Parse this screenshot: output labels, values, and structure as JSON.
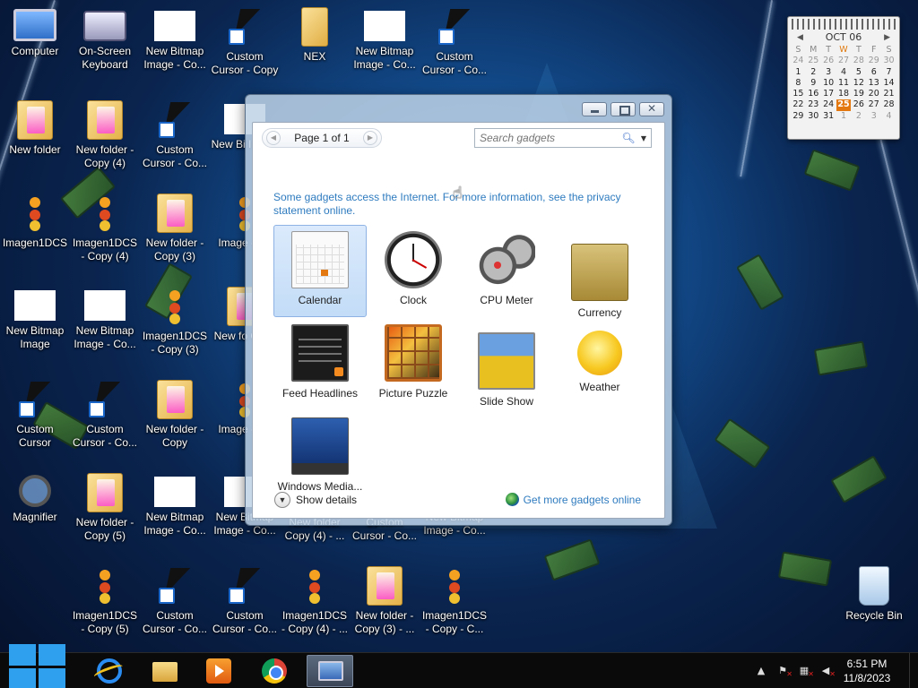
{
  "desktop": {
    "icons": [
      {
        "label": "Computer",
        "type": "computer"
      },
      {
        "label": "On-Screen Keyboard",
        "type": "keyboard"
      },
      {
        "label": "New Bitmap Image - Co...",
        "type": "bitmap"
      },
      {
        "label": "Custom Cursor - Copy",
        "type": "cursor"
      },
      {
        "label": "NEX",
        "type": "nex"
      },
      {
        "label": "New Bitmap Image - Co...",
        "type": "bitmap"
      },
      {
        "label": "Custom Cursor - Co...",
        "type": "cursor"
      },
      {
        "label": "New folder",
        "type": "folder"
      },
      {
        "label": "New folder - Copy (4)",
        "type": "folder"
      },
      {
        "label": "Custom Cursor - Co...",
        "type": "cursor"
      },
      {
        "label": "New Bi Image",
        "type": "bitmap"
      },
      {
        "label": "Imagen1DCS",
        "type": "imagen"
      },
      {
        "label": "Imagen1DCS - Copy (4)",
        "type": "imagen"
      },
      {
        "label": "New folder - Copy (3)",
        "type": "folder"
      },
      {
        "label": "Image - Co",
        "type": "imagen"
      },
      {
        "label": "New Bitmap Image",
        "type": "bitmap"
      },
      {
        "label": "New Bitmap Image - Co...",
        "type": "bitmap"
      },
      {
        "label": "Imagen1DCS - Copy (3)",
        "type": "imagen"
      },
      {
        "label": "New fo Copy",
        "type": "folder"
      },
      {
        "label": "Custom Cursor",
        "type": "cursor"
      },
      {
        "label": "Custom Cursor - Co...",
        "type": "cursor"
      },
      {
        "label": "New folder - Copy",
        "type": "folder"
      },
      {
        "label": "Image - Co",
        "type": "imagen"
      },
      {
        "label": "Magnifier",
        "type": "magnifier"
      },
      {
        "label": "New folder - Copy (5)",
        "type": "folder"
      },
      {
        "label": "New Bitmap Image - Co...",
        "type": "bitmap"
      },
      {
        "label": "New Bitmap Image - Co...",
        "type": "bitmap"
      },
      {
        "label": "New folder Copy (4) - ...",
        "type": "folder"
      },
      {
        "label": "Custom Cursor - Co...",
        "type": "cursor"
      },
      {
        "label": "New Bitmap Image - Co...",
        "type": "bitmap"
      },
      {
        "label": "Imagen1DCS - Copy (5)",
        "type": "imagen"
      },
      {
        "label": "Custom Cursor - Co...",
        "type": "cursor"
      },
      {
        "label": "Custom Cursor - Co...",
        "type": "cursor"
      },
      {
        "label": "Imagen1DCS - Copy (4) - ...",
        "type": "imagen"
      },
      {
        "label": "New folder - Copy (3) - ...",
        "type": "folder"
      },
      {
        "label": "Imagen1DCS - Copy - C...",
        "type": "imagen"
      },
      {
        "label": "Recycle Bin",
        "type": "recycle"
      }
    ]
  },
  "calendar_gadget": {
    "month": "OCT 06",
    "dows": [
      "S",
      "M",
      "T",
      "W",
      "T",
      "F",
      "S"
    ],
    "weeks": [
      [
        "24",
        "25",
        "26",
        "27",
        "28",
        "29",
        "30"
      ],
      [
        "1",
        "2",
        "3",
        "4",
        "5",
        "6",
        "7"
      ],
      [
        "8",
        "9",
        "10",
        "11",
        "12",
        "13",
        "14"
      ],
      [
        "15",
        "16",
        "17",
        "18",
        "19",
        "20",
        "21"
      ],
      [
        "22",
        "23",
        "24",
        "25",
        "26",
        "27",
        "28"
      ],
      [
        "29",
        "30",
        "31",
        "1",
        "2",
        "3",
        "4"
      ]
    ],
    "today": "25"
  },
  "gadget_window": {
    "pager": {
      "text": "Page 1 of 1",
      "prev": "◀",
      "next": "▶"
    },
    "search": {
      "placeholder": "Search gadgets"
    },
    "notice": "Some gadgets access the Internet.  For more information, see the privacy statement online.",
    "gadgets": [
      {
        "label": "Calendar",
        "icon": "calendar-icon",
        "selected": true
      },
      {
        "label": "Clock",
        "icon": "clock-icon",
        "selected": false
      },
      {
        "label": "CPU Meter",
        "icon": "cpu-meter-icon",
        "selected": false
      },
      {
        "label": "Currency",
        "icon": "currency-icon",
        "selected": false
      },
      {
        "label": "Feed Headlines",
        "icon": "feed-headlines-icon",
        "selected": false
      },
      {
        "label": "Picture Puzzle",
        "icon": "picture-puzzle-icon",
        "selected": false
      },
      {
        "label": "Slide Show",
        "icon": "slide-show-icon",
        "selected": false
      },
      {
        "label": "Weather",
        "icon": "weather-icon",
        "selected": false
      },
      {
        "label": "Windows Media...",
        "icon": "windows-media-center-icon",
        "selected": false
      }
    ],
    "show_details": "Show details",
    "get_more": "Get more gadgets online"
  },
  "taskbar": {
    "apps": [
      "internet-explorer",
      "windows-explorer",
      "media-player",
      "chrome",
      "desktop-gadgets"
    ],
    "active_app": "desktop-gadgets",
    "clock": {
      "time": "6:51 PM",
      "date": "11/8/2023"
    }
  },
  "colors": {
    "accent_link": "#2e7bbf",
    "selection": "#c3dcf7",
    "calendar_today": "#e47810",
    "start_blue": "#2ea0ee"
  }
}
